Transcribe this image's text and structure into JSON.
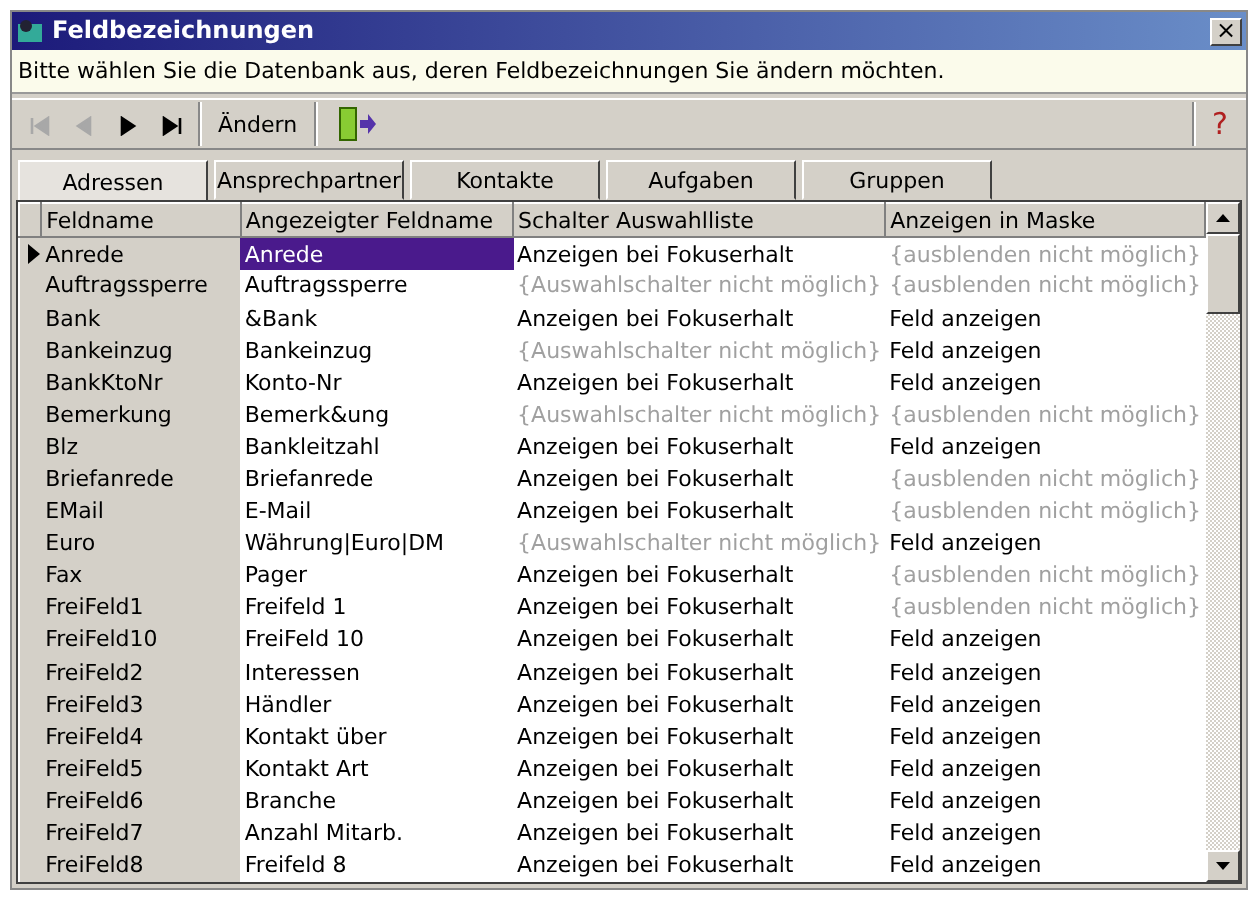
{
  "window": {
    "title": "Feldbezeichnungen",
    "close": "×"
  },
  "instruction": "Bitte wählen Sie die Datenbank aus, deren Feldbezeichnungen Sie ändern möchten.",
  "toolbar": {
    "nav_buttons": [
      {
        "kind": "first",
        "disabled": true
      },
      {
        "kind": "prev",
        "disabled": true
      },
      {
        "kind": "next",
        "disabled": false
      },
      {
        "kind": "last",
        "disabled": false
      }
    ],
    "edit_button": "Ändern",
    "help": "?"
  },
  "tabs": [
    {
      "label": "Adressen",
      "selected": true
    },
    {
      "label": "Ansprechpartner",
      "selected": false
    },
    {
      "label": "Kontakte",
      "selected": false
    },
    {
      "label": "Aufgaben",
      "selected": false
    },
    {
      "label": "Gruppen",
      "selected": false
    }
  ],
  "table": {
    "columns": [
      "Feldname",
      "Angezeigter Feldname",
      "Schalter Auswahlliste",
      "Anzeigen in Maske"
    ],
    "rows": [
      {
        "selected": true,
        "field": "Anrede",
        "display": "Anrede",
        "switch": {
          "text": "Anzeigen bei Fokuserhalt",
          "disabled": false
        },
        "mask": {
          "text": "{ausblenden nicht möglich}",
          "disabled": true
        }
      },
      {
        "selected": false,
        "field": "Auftragssperre",
        "display": "Auftragssperre",
        "switch": {
          "text": "{Auswahlschalter nicht möglich}",
          "disabled": true
        },
        "mask": {
          "text": "{ausblenden nicht möglich}",
          "disabled": true
        }
      },
      {
        "selected": false,
        "field": "Bank",
        "display": "&Bank",
        "switch": {
          "text": "Anzeigen bei Fokuserhalt",
          "disabled": false
        },
        "mask": {
          "text": "Feld anzeigen",
          "disabled": false
        }
      },
      {
        "selected": false,
        "field": "Bankeinzug",
        "display": "Bankeinzug",
        "switch": {
          "text": "{Auswahlschalter nicht möglich}",
          "disabled": true
        },
        "mask": {
          "text": "Feld anzeigen",
          "disabled": false
        }
      },
      {
        "selected": false,
        "field": "BankKtoNr",
        "display": "Konto-Nr",
        "switch": {
          "text": "Anzeigen bei Fokuserhalt",
          "disabled": false
        },
        "mask": {
          "text": "Feld anzeigen",
          "disabled": false
        }
      },
      {
        "selected": false,
        "field": "Bemerkung",
        "display": "Bemerk&ung",
        "switch": {
          "text": "{Auswahlschalter nicht möglich}",
          "disabled": true
        },
        "mask": {
          "text": "{ausblenden nicht möglich}",
          "disabled": true
        }
      },
      {
        "selected": false,
        "field": "Blz",
        "display": "Bankleitzahl",
        "switch": {
          "text": "Anzeigen bei Fokuserhalt",
          "disabled": false
        },
        "mask": {
          "text": "Feld anzeigen",
          "disabled": false
        }
      },
      {
        "selected": false,
        "field": "Briefanrede",
        "display": "Briefanrede",
        "switch": {
          "text": "Anzeigen bei Fokuserhalt",
          "disabled": false
        },
        "mask": {
          "text": "{ausblenden nicht möglich}",
          "disabled": true
        }
      },
      {
        "selected": false,
        "field": "EMail",
        "display": "E-Mail",
        "switch": {
          "text": "Anzeigen bei Fokuserhalt",
          "disabled": false
        },
        "mask": {
          "text": "{ausblenden nicht möglich}",
          "disabled": true
        }
      },
      {
        "selected": false,
        "field": "Euro",
        "display": "Währung|Euro|DM",
        "switch": {
          "text": "{Auswahlschalter nicht möglich}",
          "disabled": true
        },
        "mask": {
          "text": "Feld anzeigen",
          "disabled": false
        }
      },
      {
        "selected": false,
        "field": "Fax",
        "display": "Pager",
        "switch": {
          "text": "Anzeigen bei Fokuserhalt",
          "disabled": false
        },
        "mask": {
          "text": "{ausblenden nicht möglich}",
          "disabled": true
        }
      },
      {
        "selected": false,
        "field": "FreiFeld1",
        "display": "Freifeld 1",
        "switch": {
          "text": "Anzeigen bei Fokuserhalt",
          "disabled": false
        },
        "mask": {
          "text": "{ausblenden nicht möglich}",
          "disabled": true
        }
      },
      {
        "selected": false,
        "field": "FreiFeld10",
        "display": "FreiFeld 10",
        "switch": {
          "text": "Anzeigen bei Fokuserhalt",
          "disabled": false
        },
        "mask": {
          "text": "Feld anzeigen",
          "disabled": false
        }
      },
      {
        "selected": false,
        "field": "FreiFeld2",
        "display": "Interessen",
        "switch": {
          "text": "Anzeigen bei Fokuserhalt",
          "disabled": false
        },
        "mask": {
          "text": "Feld anzeigen",
          "disabled": false
        }
      },
      {
        "selected": false,
        "field": "FreiFeld3",
        "display": "Händler",
        "switch": {
          "text": "Anzeigen bei Fokuserhalt",
          "disabled": false
        },
        "mask": {
          "text": "Feld anzeigen",
          "disabled": false
        }
      },
      {
        "selected": false,
        "field": "FreiFeld4",
        "display": "Kontakt über",
        "switch": {
          "text": "Anzeigen bei Fokuserhalt",
          "disabled": false
        },
        "mask": {
          "text": "Feld anzeigen",
          "disabled": false
        }
      },
      {
        "selected": false,
        "field": "FreiFeld5",
        "display": "Kontakt Art",
        "switch": {
          "text": "Anzeigen bei Fokuserhalt",
          "disabled": false
        },
        "mask": {
          "text": "Feld anzeigen",
          "disabled": false
        }
      },
      {
        "selected": false,
        "field": "FreiFeld6",
        "display": "Branche",
        "switch": {
          "text": "Anzeigen bei Fokuserhalt",
          "disabled": false
        },
        "mask": {
          "text": "Feld anzeigen",
          "disabled": false
        }
      },
      {
        "selected": false,
        "field": "FreiFeld7",
        "display": "Anzahl Mitarb.",
        "switch": {
          "text": "Anzeigen bei Fokuserhalt",
          "disabled": false
        },
        "mask": {
          "text": "Feld anzeigen",
          "disabled": false
        }
      },
      {
        "selected": false,
        "field": "FreiFeld8",
        "display": "Freifeld 8",
        "switch": {
          "text": "Anzeigen bei Fokuserhalt",
          "disabled": false
        },
        "mask": {
          "text": "Feld anzeigen",
          "disabled": false
        }
      }
    ]
  }
}
